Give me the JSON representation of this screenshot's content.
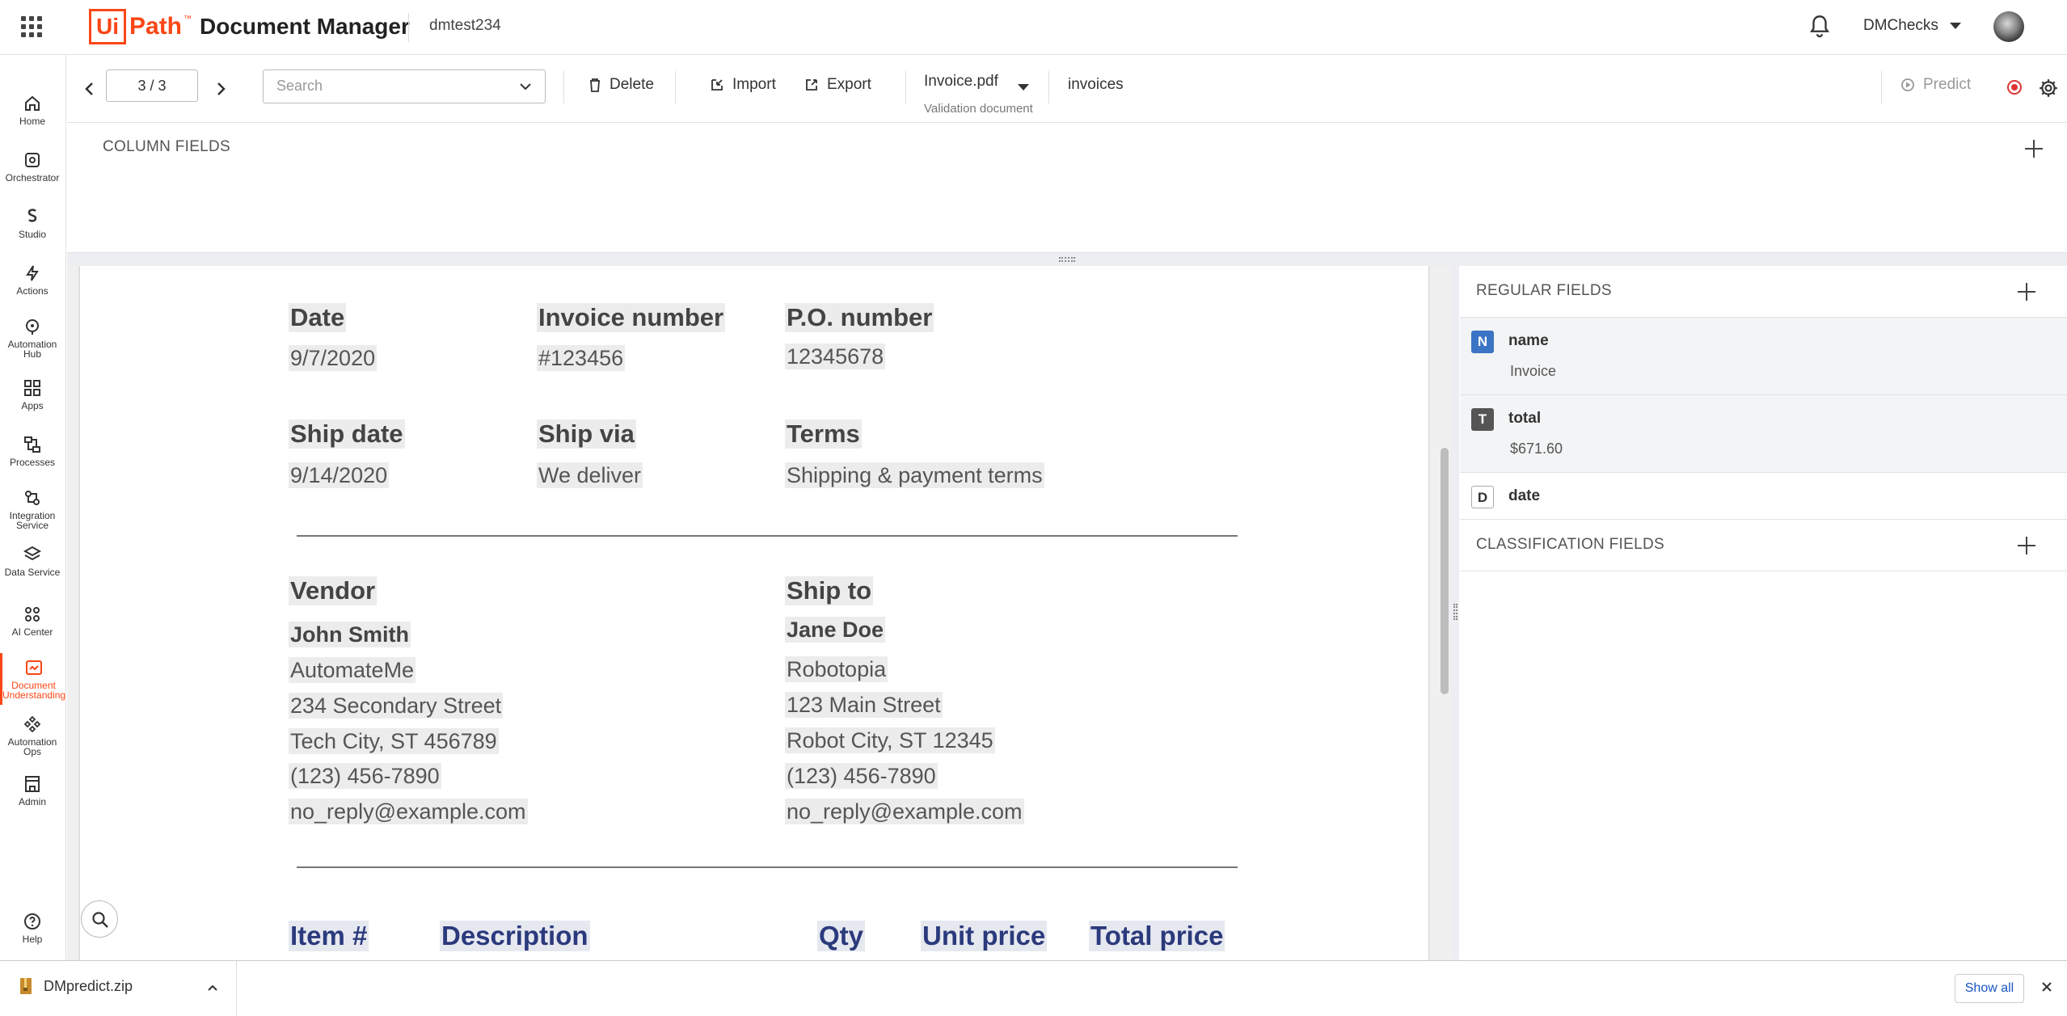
{
  "header": {
    "logo_ui": "Ui",
    "logo_path": "Path",
    "logo_tm": "™",
    "product": "Document Manager",
    "tenant": "dmtest234",
    "org": "DMChecks"
  },
  "nav": [
    {
      "id": "home",
      "label": "Home"
    },
    {
      "id": "orchestrator",
      "label": "Orchestrator"
    },
    {
      "id": "studio",
      "label": "Studio"
    },
    {
      "id": "actions",
      "label": "Actions"
    },
    {
      "id": "automation-hub",
      "label": "Automation Hub"
    },
    {
      "id": "apps",
      "label": "Apps"
    },
    {
      "id": "processes",
      "label": "Processes"
    },
    {
      "id": "integration-service",
      "label": "Integration Service"
    },
    {
      "id": "data-service",
      "label": "Data Service"
    },
    {
      "id": "ai-center",
      "label": "AI Center"
    },
    {
      "id": "document-understanding",
      "label": "Document Understanding",
      "active": true
    },
    {
      "id": "automation-ops",
      "label": "Automation Ops"
    },
    {
      "id": "admin",
      "label": "Admin"
    }
  ],
  "nav_help": "Help",
  "toolbar": {
    "page": "3 / 3",
    "search_placeholder": "Search",
    "delete": "Delete",
    "import": "Import",
    "export": "Export",
    "document": "Invoice.pdf",
    "document_sub": "Validation document",
    "doc_type": "invoices",
    "predict": "Predict"
  },
  "column_fields": {
    "title": "COLUMN FIELDS"
  },
  "document": {
    "date_label": "Date",
    "date_value": "9/7/2020",
    "invoice_label": "Invoice number",
    "invoice_value": "#123456",
    "po_label": "P.O. number",
    "po_value": "12345678",
    "ship_date_label": "Ship date",
    "ship_date_value": "9/14/2020",
    "ship_via_label": "Ship via",
    "ship_via_value": "We deliver",
    "terms_label": "Terms",
    "terms_value": "Shipping & payment terms",
    "vendor_label": "Vendor",
    "vendor_lines": [
      "John Smith",
      "AutomateMe",
      "234 Secondary Street",
      "Tech City, ST 456789",
      "(123) 456-7890",
      "no_reply@example.com"
    ],
    "shipto_label": "Ship to",
    "shipto_lines": [
      "Jane Doe",
      "Robotopia",
      "123 Main Street",
      "Robot City, ST 12345",
      "(123) 456-7890",
      "no_reply@example.com"
    ],
    "table_headers": [
      "Item #",
      "Description",
      "Qty",
      "Unit price",
      "Total price"
    ]
  },
  "regular_fields": {
    "title": "REGULAR FIELDS",
    "fields": [
      {
        "type": "N",
        "name": "name",
        "value": "Invoice"
      },
      {
        "type": "T",
        "name": "total",
        "value": "$671.60"
      },
      {
        "type": "D",
        "name": "date",
        "value": ""
      }
    ]
  },
  "classification_fields": {
    "title": "CLASSIFICATION FIELDS"
  },
  "download_bar": {
    "file": "DMpredict.zip",
    "show_all": "Show all"
  },
  "colors": {
    "brand": "#fa4616",
    "table_header": "#2b3a7c",
    "field_type_n": "#3b74c4"
  }
}
